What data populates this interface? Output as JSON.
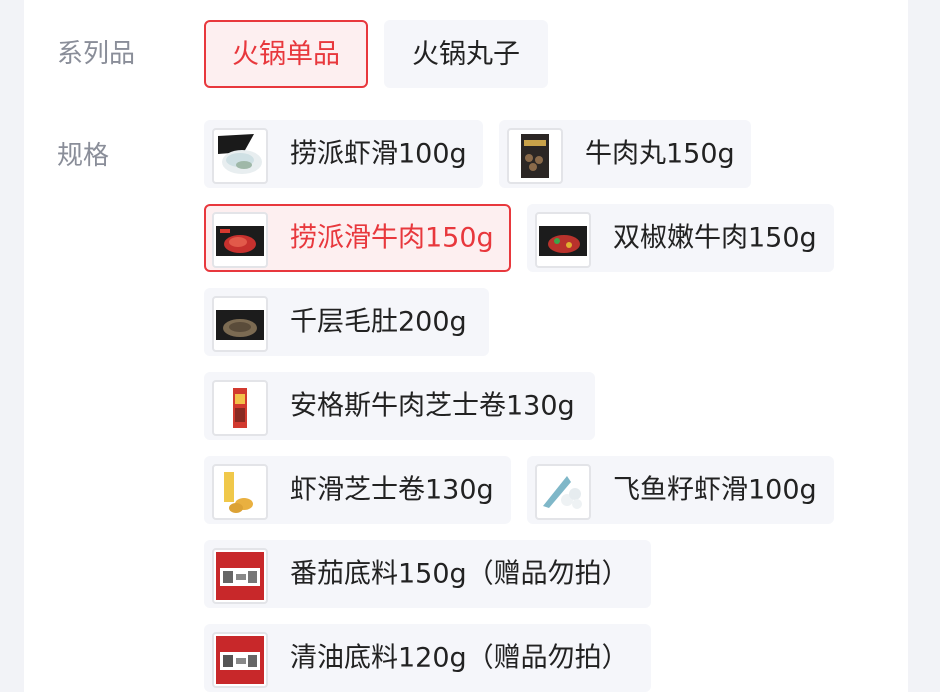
{
  "series_label": "系列品",
  "series": [
    {
      "label": "火锅单品",
      "selected": true
    },
    {
      "label": "火锅丸子",
      "selected": false
    }
  ],
  "spec_label": "规格",
  "specs": [
    {
      "label": "捞派虾滑100g",
      "thumb": "shrimp-paste-product-thumbnail",
      "selected": false
    },
    {
      "label": "牛肉丸150g",
      "thumb": "beef-ball-product-thumbnail",
      "selected": false
    },
    {
      "label": "捞派滑牛肉150g",
      "thumb": "sliced-beef-product-thumbnail",
      "selected": true
    },
    {
      "label": "双椒嫩牛肉150g",
      "thumb": "pepper-beef-product-thumbnail",
      "selected": false
    },
    {
      "label": "千层毛肚200g",
      "thumb": "tripe-product-thumbnail",
      "selected": false
    },
    {
      "label": "安格斯牛肉芝士卷130g",
      "thumb": "beef-cheese-roll-product-thumbnail",
      "selected": false
    },
    {
      "label": "虾滑芝士卷130g",
      "thumb": "shrimp-cheese-roll-product-thumbnail",
      "selected": false
    },
    {
      "label": "飞鱼籽虾滑100g",
      "thumb": "roe-shrimp-paste-product-thumbnail",
      "selected": false
    },
    {
      "label": "番茄底料150g（赠品勿拍）",
      "thumb": "tomato-soup-base-product-thumbnail",
      "selected": false
    },
    {
      "label": "清油底料120g（赠品勿拍）",
      "thumb": "oil-soup-base-product-thumbnail",
      "selected": false
    }
  ],
  "colors": {
    "accent": "#e8383d",
    "option_bg": "#f5f6fa",
    "label_gray": "#8a8e99"
  }
}
